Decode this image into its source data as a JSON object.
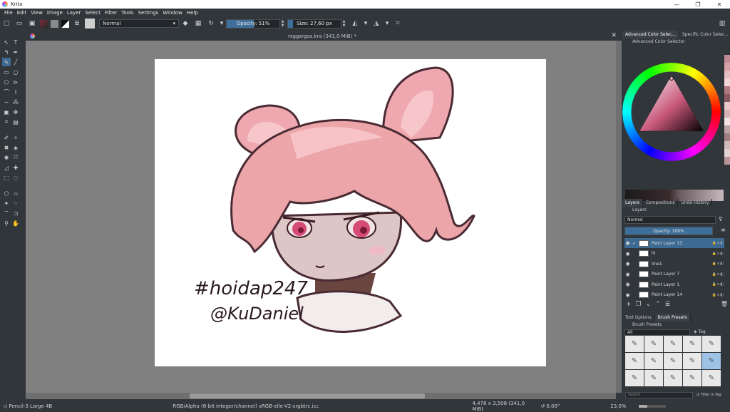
{
  "app": {
    "title": "Krita"
  },
  "window_controls": {
    "minimize": "—",
    "maximize": "❐",
    "close": "✕"
  },
  "menu": [
    "File",
    "Edit",
    "View",
    "Image",
    "Layer",
    "Select",
    "Filter",
    "Tools",
    "Settings",
    "Window",
    "Help"
  ],
  "toolbar": {
    "blend_mode": "Normal",
    "opacity": {
      "label": "Opacity: 51%",
      "value": 0.51
    },
    "size": {
      "label": "Size: 27,60 px",
      "value": 0.09
    }
  },
  "document": {
    "tab_title": "rsggsrgsa.kra (341,0 MiB) *",
    "close": "✕"
  },
  "artwork": {
    "line1": "#hoidap247",
    "line2": "@KuDaniel"
  },
  "status": {
    "brush": "Pencil-3 Large 4B",
    "color_space": "RGB/Alpha (8-bit integer/channel)  sRGB-elle-V2-srgbtrc.icc",
    "dimensions": "4,478 x 3,508 (341,0 MiB)",
    "rotation": "0,00°",
    "zoom": "23,0%"
  },
  "dock": {
    "color_tabs": [
      "Advanced Color Selec...",
      "Specific Color Selec..."
    ],
    "color_title": "Advanced Color Selector",
    "layer_tabs": [
      "Layers",
      "Compositions",
      "Undo History"
    ],
    "layers_title": "Layers",
    "layers_blend": "Normal",
    "layers_opacity": {
      "label": "Opacity: 100%",
      "value": 1.0
    },
    "layers": [
      {
        "name": "Paint Layer 13",
        "selected": true
      },
      {
        "name": "hl",
        "selected": false
      },
      {
        "name": "line1",
        "selected": false
      },
      {
        "name": "Paint Layer 7",
        "selected": false
      },
      {
        "name": "Paint Layer 1",
        "selected": false
      },
      {
        "name": "Paint Layer 14",
        "selected": false
      }
    ],
    "brush_tabs": [
      "Tool Options",
      "Brush Presets"
    ],
    "brush_title": "Brush Presets",
    "brush_filter": "All",
    "brush_tag": "Tag",
    "search_placeholder": "Search",
    "filter_in_tag": "Filter in Tag"
  }
}
